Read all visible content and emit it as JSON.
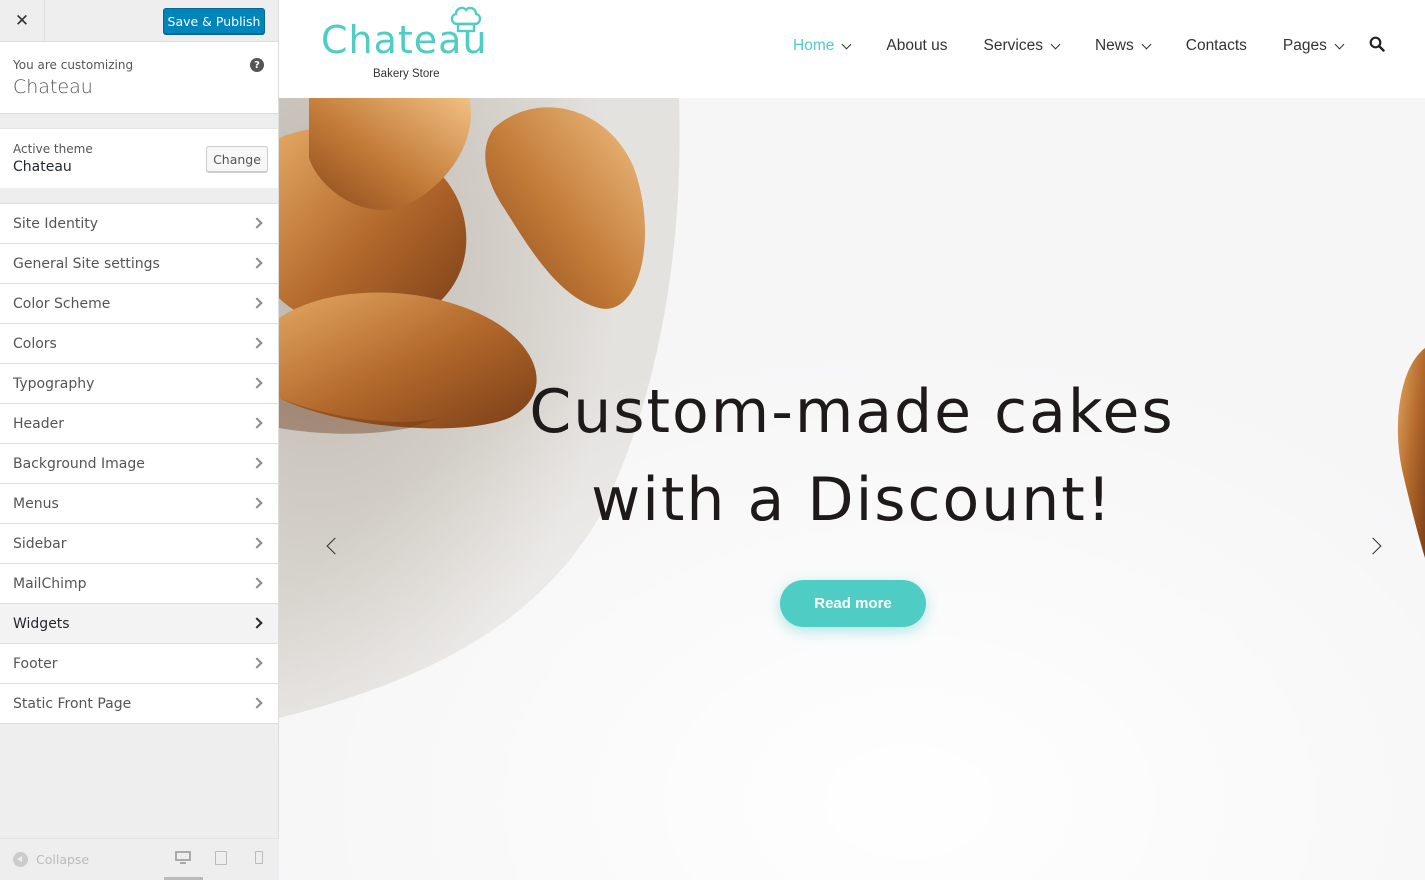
{
  "customizer": {
    "save_label": "Save & Publish",
    "customizing_label": "You are customizing",
    "site_name": "Chateau",
    "active_theme_label": "Active theme",
    "active_theme": "Chateau",
    "change_label": "Change",
    "panels": [
      {
        "label": "Site Identity"
      },
      {
        "label": "General Site settings"
      },
      {
        "label": "Color Scheme"
      },
      {
        "label": "Colors"
      },
      {
        "label": "Typography"
      },
      {
        "label": "Header"
      },
      {
        "label": "Background Image"
      },
      {
        "label": "Menus"
      },
      {
        "label": "Sidebar"
      },
      {
        "label": "MailChimp"
      },
      {
        "label": "Widgets"
      },
      {
        "label": "Footer"
      },
      {
        "label": "Static Front Page"
      }
    ],
    "active_panel": "Widgets",
    "collapse_label": "Collapse"
  },
  "site": {
    "logo_text": "Chateau",
    "tagline": "Bakery Store",
    "accent_color": "#4fcdc4",
    "nav": [
      {
        "label": "Home",
        "dropdown": true,
        "active": true
      },
      {
        "label": "About us",
        "dropdown": false
      },
      {
        "label": "Services",
        "dropdown": true
      },
      {
        "label": "News",
        "dropdown": true
      },
      {
        "label": "Contacts",
        "dropdown": false
      },
      {
        "label": "Pages",
        "dropdown": true
      }
    ],
    "hero": {
      "title_line1": "Custom-made cakes",
      "title_line2": "with a Discount!",
      "button_label": "Read more"
    }
  }
}
